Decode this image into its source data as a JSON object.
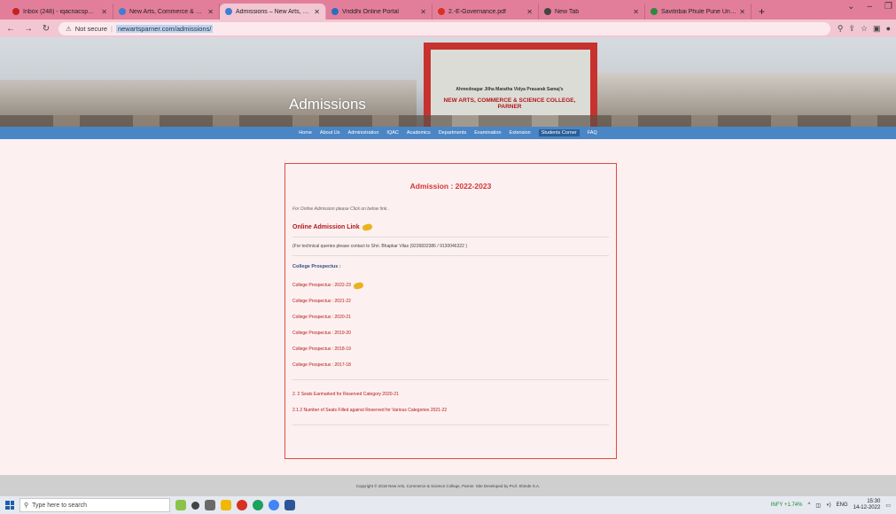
{
  "browser": {
    "tabs": [
      {
        "title": "Inbox (248) - iqacnacsp@gmail",
        "color": "#c5221f",
        "active": false
      },
      {
        "title": "New Arts, Commerce & Science",
        "color": "#3f7dd1",
        "active": false
      },
      {
        "title": "Admissions – New Arts, Comme",
        "color": "#3f7dd1",
        "active": true
      },
      {
        "title": "Vriddhi Online Portal",
        "color": "#2a6fbd",
        "active": false
      },
      {
        "title": "2.-E-Governance.pdf",
        "color": "#d93025",
        "active": false
      },
      {
        "title": "New Tab",
        "color": "#444444",
        "active": false
      },
      {
        "title": "Savitribai Phule Pune University",
        "color": "#2b8a3e",
        "active": false
      }
    ],
    "new_tab": "+",
    "address": {
      "security": "Not secure",
      "url": "newartsparner.com/admissions/"
    }
  },
  "hero": {
    "title": "Admissions",
    "gate_line1": "Ahmednagar Jilha Maratha Vidya Prasarak Samaj's",
    "gate_line2": "NEW ARTS, COMMERCE & SCIENCE COLLEGE, PARNER"
  },
  "nav": {
    "items": [
      "Home",
      "About Us",
      "Administration",
      "IQAC",
      "Academics",
      "Departments",
      "Examination",
      "Extension",
      "Students Corner",
      "FAQ"
    ],
    "active": "Students Corner"
  },
  "content": {
    "title": "Admission : 2022-2023",
    "intro": "For Online Admission please Click on below link..",
    "online_link": "Online Admission Link",
    "contact": "(For technical queries please contact to Shri. Bhapkar Vilas (9226832386 / 9130046322 )",
    "prospectus_heading": "College Prospectus :",
    "prospectus": [
      {
        "label": "College Prospectus : 2022-23",
        "new": true
      },
      {
        "label": "College Prospectus : 2021-22",
        "new": false
      },
      {
        "label": "College Prospectus : 2020-21",
        "new": false
      },
      {
        "label": "College Prospectus : 2019-20",
        "new": false
      },
      {
        "label": "College Prospectus : 2018-19",
        "new": false
      },
      {
        "label": "College Prospectus : 2017-18",
        "new": false
      }
    ],
    "extra_links": [
      "2. 2 Seats Earmarked for Reserved Category 2020-21",
      "2.1.2 Number of Seats Filled against Reserved for Various Categories 2021-22"
    ]
  },
  "footer": {
    "text": "Copyright © 2018 New Arts, Commerce & Science College, Parner. Site Developed by Prof. Shinde S.A."
  },
  "taskbar": {
    "search_placeholder": "Type here to search",
    "stock": "INFY +1.74%",
    "lang": "ENG",
    "time": "15:30",
    "date": "14-12-2022"
  }
}
